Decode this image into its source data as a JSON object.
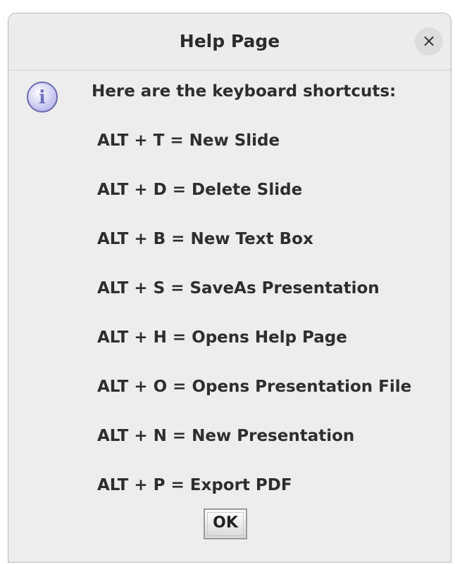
{
  "window": {
    "title": "Help Page",
    "close_icon": "×"
  },
  "message": {
    "icon": "info-icon",
    "icon_glyph": "i",
    "heading": "Here are the keyboard shortcuts:",
    "shortcuts": [
      "ALT + T = New Slide",
      "ALT + D = Delete Slide",
      "ALT + B = New Text Box",
      "ALT + S = SaveAs Presentation",
      "ALT + H = Opens Help Page",
      "ALT + O = Opens Presentation File",
      "ALT + N = New Presentation",
      "ALT + P = Export PDF"
    ]
  },
  "buttons": {
    "ok_label": "OK"
  },
  "colors": {
    "dialog_bg": "#ededed",
    "info_icon_fill": "#c8c8f0",
    "info_icon_stroke": "#6a6ab0"
  }
}
